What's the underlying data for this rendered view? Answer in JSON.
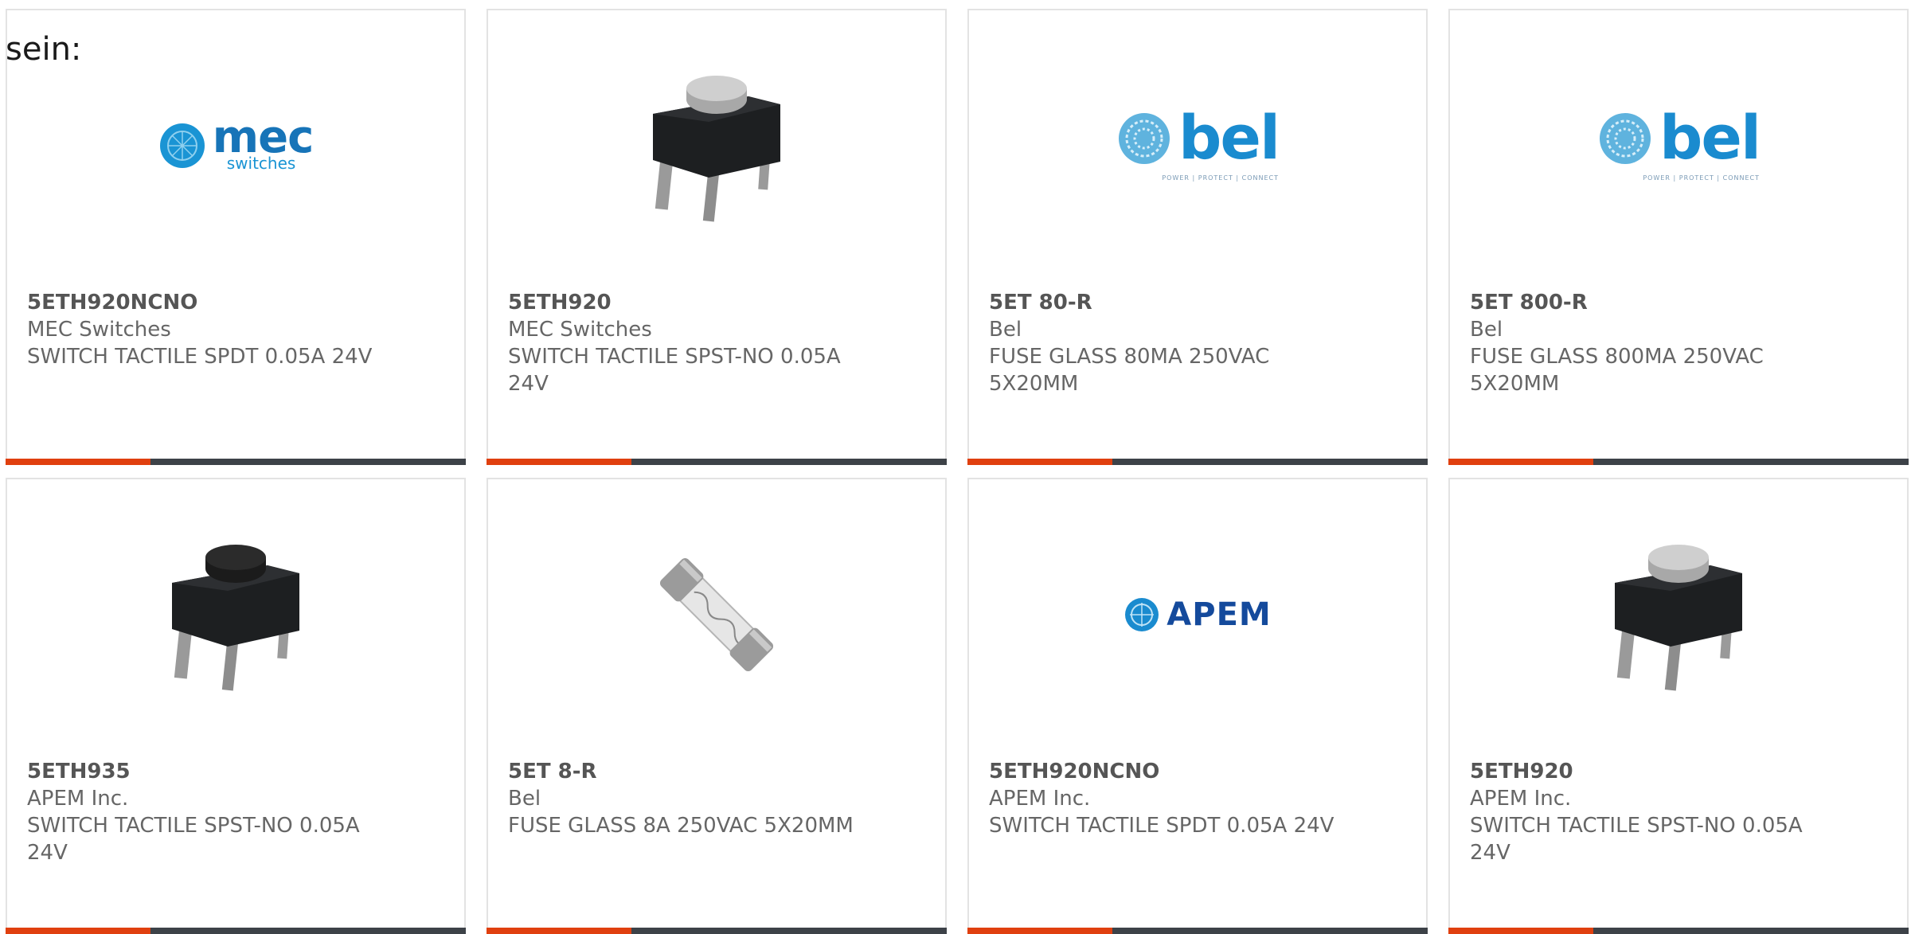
{
  "lead_text": "sein:",
  "colors": {
    "accent": "#e0400f",
    "bar": "#3d4248",
    "border": "#e3e3e3"
  },
  "cards": [
    {
      "part": "5ETH920NCNO",
      "maker": "MEC Switches",
      "desc": "SWITCH TACTILE SPDT 0.05A 24V",
      "image": "mec-switches-logo",
      "logo_text": "mec",
      "logo_sub": "switches"
    },
    {
      "part": "5ETH920",
      "maker": "MEC Switches",
      "desc": "SWITCH TACTILE SPST-NO 0.05A 24V",
      "image": "tactile-switch-photo"
    },
    {
      "part": "5ET 80-R",
      "maker": "Bel",
      "desc": "FUSE GLASS 80MA 250VAC 5X20MM",
      "image": "bel-logo",
      "logo_text": "bel",
      "logo_sub": "POWER | PROTECT | CONNECT"
    },
    {
      "part": "5ET 800-R",
      "maker": "Bel",
      "desc": "FUSE GLASS 800MA 250VAC 5X20MM",
      "image": "bel-logo",
      "logo_text": "bel",
      "logo_sub": "POWER | PROTECT | CONNECT"
    },
    {
      "part": "5ETH935",
      "maker": "APEM Inc.",
      "desc": "SWITCH TACTILE SPST-NO 0.05A 24V",
      "image": "tactile-switch-photo"
    },
    {
      "part": "5ET 8-R",
      "maker": "Bel",
      "desc": "FUSE GLASS 8A 250VAC 5X20MM",
      "image": "glass-fuse-photo"
    },
    {
      "part": "5ETH920NCNO",
      "maker": "APEM Inc.",
      "desc": "SWITCH TACTILE SPDT 0.05A 24V",
      "image": "apem-logo",
      "logo_text": "APEM"
    },
    {
      "part": "5ETH920",
      "maker": "APEM Inc.",
      "desc": "SWITCH TACTILE SPST-NO 0.05A 24V",
      "image": "tactile-switch-photo"
    }
  ]
}
